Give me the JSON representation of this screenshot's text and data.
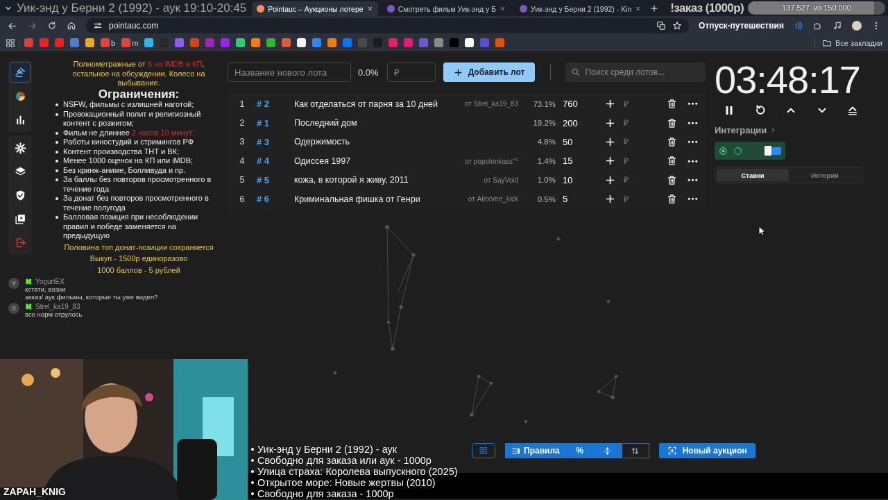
{
  "overlay": {
    "stream_title": "Уик-энд у Берни 2 (1992) - аук 19:10-20:45",
    "order_label": "!заказ (1000р)",
    "goal": {
      "reading": "137 527  из 150 000",
      "level": 0.917,
      "name": "Отпуск-путешествия"
    },
    "streamer": "ZAPAH_KNIG",
    "queue": [
      "Уик-энд у Берни 2 (1992) - аук",
      "Свободно для заказа или аук - 1000р",
      "Улица страха: Королева выпускного (2025)",
      "Открытое море: Новые жертвы (2010)",
      "Свободно для заказа - 1000р"
    ],
    "chat": [
      {
        "avatar": "Y",
        "user": "YogurtEX",
        "lines": [
          "кстати, возни",
          "заказ/ аук фильмы, которые ты уже видел?"
        ]
      },
      {
        "avatar": "S",
        "user": "Strel_ka19_83",
        "lines": [
          "все норм отрулось"
        ]
      }
    ]
  },
  "browser": {
    "tabs": [
      {
        "title": "Pointauc – Аукционы лотере",
        "selected": true
      },
      {
        "title": "Смотреть фильм Уик-энд у Б",
        "selected": false
      },
      {
        "title": "Уик-энд у Берни 2 (1992) - Kin",
        "selected": false
      }
    ],
    "url": "pointauc.com",
    "bookmarks": [
      {
        "color": "#e53935"
      },
      {
        "color": "#ff1a1a"
      },
      {
        "color": "#ff1a1a"
      },
      {
        "color": "#4a7fd8"
      },
      {
        "color": "#f2a900"
      },
      {
        "color": "#ea4335",
        "label": "b"
      },
      {
        "color": "#ea4335",
        "label": "m"
      },
      {
        "color": "#29b6f6"
      },
      {
        "color": "#2a2a2a"
      },
      {
        "color": "#8e5cf0"
      },
      {
        "color": "#d84315"
      },
      {
        "color": "#9c27b0"
      },
      {
        "color": "#a020f0"
      },
      {
        "color": "#2ecc71"
      },
      {
        "color": "#ff7a00"
      },
      {
        "color": "#2eb82e"
      },
      {
        "color": "#e2583a"
      },
      {
        "color": "#f5f5f5"
      },
      {
        "color": "#2d88ff"
      },
      {
        "color": "#f57c00"
      },
      {
        "color": "#0077ff"
      },
      {
        "color": "#4a4a4a"
      },
      {
        "color": "#1a1a1a"
      },
      {
        "color": "#e91e63"
      },
      {
        "color": "#e6197a"
      },
      {
        "color": "#6a5acd"
      },
      {
        "color": "#8a8a8a"
      },
      {
        "color": "#000000"
      },
      {
        "color": "#ffffff"
      },
      {
        "color": "#5b4bd6"
      },
      {
        "color": "#e65100"
      }
    ],
    "all_bookmarks": "Все закладки"
  },
  "sidebar": {
    "groups": [
      {
        "items": [
          {
            "selected": true
          },
          {
            "selected": false
          },
          {
            "selected": false
          }
        ]
      },
      {
        "items": [
          {
            "selected": false
          },
          {
            "selected": false
          },
          {
            "selected": false
          },
          {
            "selected": false
          },
          {
            "selected": false
          }
        ]
      }
    ]
  },
  "rules": {
    "intro": [
      {
        "text": "Полнометражные от ",
        "highlight": false
      },
      {
        "text": "6 на IMDB и КП",
        "highlight": true
      },
      {
        "text": ", остальное на обсуждении. Колесо на выбывание.",
        "highlight": false
      }
    ],
    "heading": "Ограничения:",
    "items": [
      [
        {
          "text": "NSFW, фильмы с излишней наготой;",
          "highlight": false
        }
      ],
      [
        {
          "text": "Провокационный полит и религиозный контент с розжигом;",
          "highlight": false
        }
      ],
      [
        {
          "text": "Фильм не длиннее ",
          "highlight": false
        },
        {
          "text": "2 часов 10 минут;",
          "highlight": true
        }
      ],
      [
        {
          "text": "Работы киностудий и стримингов РФ",
          "highlight": false
        }
      ],
      [
        {
          "text": "Контент производства ТНТ и ВК;",
          "highlight": false
        }
      ],
      [
        {
          "text": "Менее 1000 оценок на КП или iMDB;",
          "highlight": false
        }
      ],
      [
        {
          "text": "Без кринж-аниме, Болливуда и пр.",
          "highlight": false
        }
      ],
      [
        {
          "text": "За баллы без повторов просмотренного в течение года",
          "highlight": false
        }
      ],
      [
        {
          "text": "За донат без повторов просмотренного в течение полугода",
          "highlight": false
        }
      ],
      [
        {
          "text": "Балловая позиция при несоблюдении правил и победе заменяется на предыдущую",
          "highlight": false
        }
      ]
    ],
    "footer": [
      "Половина топ донат-позиции сохраняется",
      "Выкуп - 1500р единоразово",
      "1000 баллов - 5 рублей"
    ]
  },
  "new_lot": {
    "name_placeholder": "Название нового лота",
    "percent": "0.0%",
    "amount_placeholder": "₽",
    "add_button": "Добавить лот",
    "search_placeholder": "Поиск среди лотов..."
  },
  "lots": [
    {
      "number": "1",
      "id": "# 2",
      "name": "Как отделаться от парня за 10 дней",
      "author": "от Strel_ka19_83",
      "percent": "73.1%",
      "amount": "760",
      "bid_placeholder": "₽"
    },
    {
      "number": "2",
      "id": "# 1",
      "name": "Последний дом",
      "percent": "19.2%",
      "amount": "200",
      "bid_placeholder": "₽"
    },
    {
      "number": "3",
      "id": "# 3",
      "name": "Одержимость",
      "percent": "4.8%",
      "amount": "50",
      "bid_placeholder": "₽"
    },
    {
      "number": "4",
      "id": "# 4",
      "name": "Одиссея 1997",
      "author": "от popolonkass$^{+1}$",
      "percent": "1.4%",
      "amount": "15",
      "bid_placeholder": "₽"
    },
    {
      "number": "5",
      "id": "# 5",
      "name": "кожа, в которой я живу, 2011",
      "author": "от SayVoid",
      "percent": "1.0%",
      "amount": "10",
      "bid_placeholder": "₽"
    },
    {
      "number": "6",
      "id": "# 6",
      "name": "Криминальная фишка от Генри",
      "author": "от AlexVee_kick",
      "percent": "0.5%",
      "amount": "5",
      "bid_placeholder": "₽"
    }
  ],
  "timer": {
    "time": "03:48:17"
  },
  "integrations": {
    "label": "Интеграции"
  },
  "history_tabs": [
    {
      "label": "Ставки",
      "selected": true
    },
    {
      "label": "История",
      "selected": false
    }
  ],
  "toolbar": {
    "segments": [
      {
        "kind": "rules",
        "label": "Правила",
        "on": true
      },
      {
        "kind": "percent",
        "label": "%",
        "on": true
      },
      {
        "kind": "split",
        "on": true
      },
      {
        "kind": "sort",
        "on": false
      }
    ],
    "new_auction": "Новый аукцион"
  }
}
